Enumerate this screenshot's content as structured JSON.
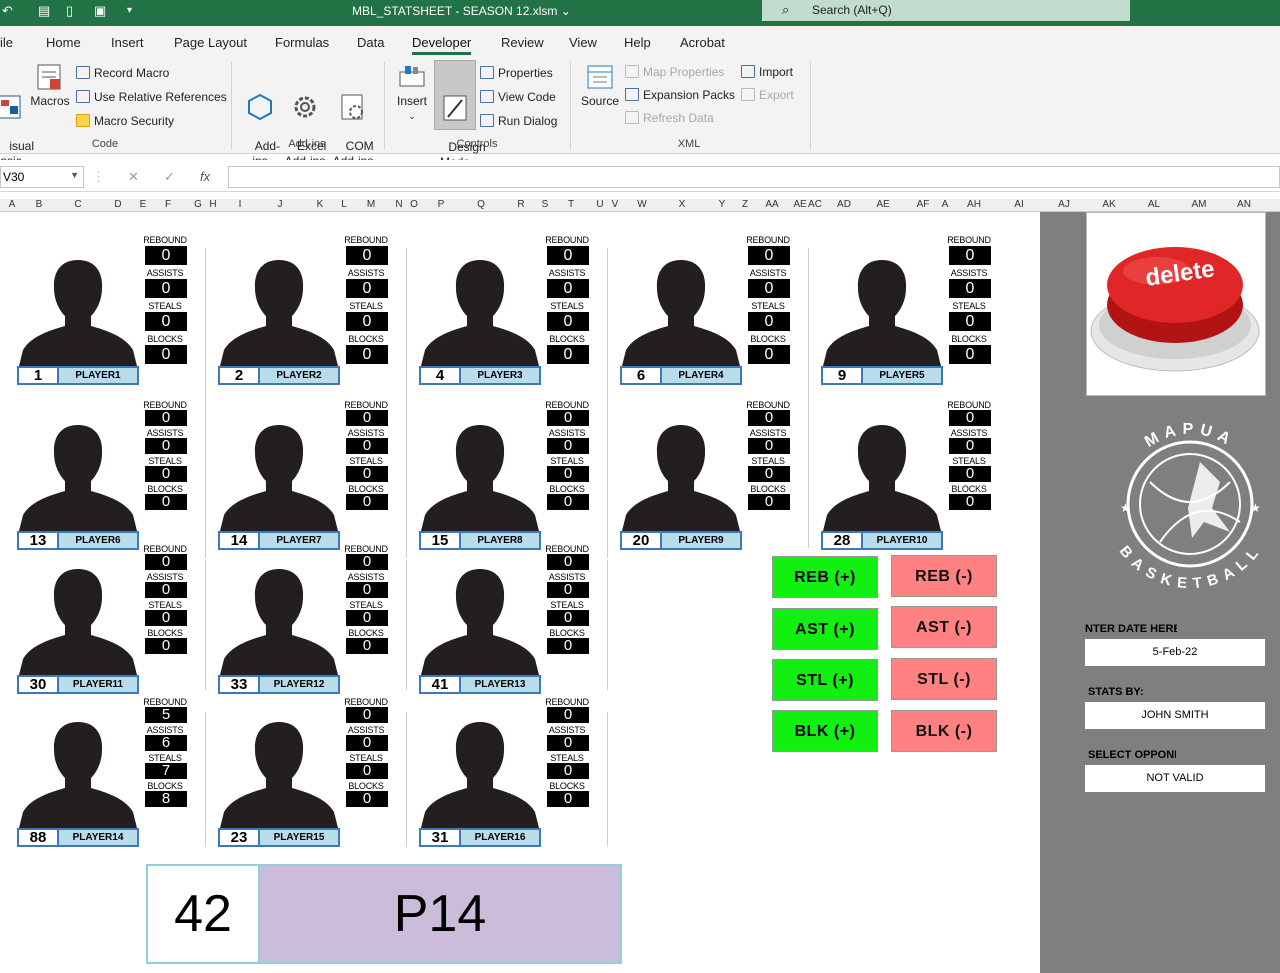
{
  "titlebar": {
    "doc_title": "MBL_STATSHEET - SEASON 12.xlsm",
    "search_placeholder": "Search (Alt+Q)"
  },
  "tabs": [
    "ile",
    "Home",
    "Insert",
    "Page Layout",
    "Formulas",
    "Data",
    "Developer",
    "Review",
    "View",
    "Help",
    "Acrobat"
  ],
  "ribbon": {
    "code": {
      "visual_basic": "isual\nasic",
      "macros": "Macros",
      "record_macro": "Record Macro",
      "relative_refs": "Use Relative References",
      "macro_security": "Macro Security",
      "group": "Code"
    },
    "addins": {
      "addins": "Add-\nins",
      "excel_addins": "Excel\nAdd-ins",
      "com_addins": "COM\nAdd-ins",
      "group": "Add-ins"
    },
    "controls": {
      "insert": "Insert",
      "design_mode": "Design\nMode",
      "properties": "Properties",
      "view_code": "View Code",
      "run_dialog": "Run Dialog",
      "group": "Controls"
    },
    "xml": {
      "source": "Source",
      "map_properties": "Map Properties",
      "expansion_packs": "Expansion Packs",
      "refresh_data": "Refresh Data",
      "import": "Import",
      "export": "Export",
      "group": "XML"
    }
  },
  "formula_bar": {
    "name_box": "V30",
    "fx": "fx"
  },
  "column_headers": [
    "A",
    "B",
    "C",
    "D",
    "E",
    "F",
    "G",
    "H",
    "I",
    "J",
    "K",
    "L",
    "M",
    "N",
    "O",
    "P",
    "Q",
    "R",
    "S",
    "T",
    "U",
    "V",
    "W",
    "X",
    "Y",
    "Z",
    "AA",
    "AE",
    "AC",
    "AD",
    "AE",
    "AF",
    "A",
    "AH",
    "AI",
    "AJ",
    "AK",
    "AL",
    "AM",
    "AN"
  ],
  "stat_labels": {
    "reb": "REBOUND",
    "ast": "ASSISTS",
    "stl": "STEALS",
    "blk": "BLOCKS"
  },
  "players": [
    {
      "num": "1",
      "name": "PLAYER1",
      "reb": "0",
      "ast": "0",
      "stl": "0",
      "blk": "0"
    },
    {
      "num": "2",
      "name": "PLAYER2",
      "reb": "0",
      "ast": "0",
      "stl": "0",
      "blk": "0"
    },
    {
      "num": "4",
      "name": "PLAYER3",
      "reb": "0",
      "ast": "0",
      "stl": "0",
      "blk": "0"
    },
    {
      "num": "6",
      "name": "PLAYER4",
      "reb": "0",
      "ast": "0",
      "stl": "0",
      "blk": "0"
    },
    {
      "num": "9",
      "name": "PLAYER5",
      "reb": "0",
      "ast": "0",
      "stl": "0",
      "blk": "0"
    },
    {
      "num": "13",
      "name": "PLAYER6",
      "reb": "0",
      "ast": "0",
      "stl": "0",
      "blk": "0"
    },
    {
      "num": "14",
      "name": "PLAYER7",
      "reb": "0",
      "ast": "0",
      "stl": "0",
      "blk": "0"
    },
    {
      "num": "15",
      "name": "PLAYER8",
      "reb": "0",
      "ast": "0",
      "stl": "0",
      "blk": "0"
    },
    {
      "num": "20",
      "name": "PLAYER9",
      "reb": "0",
      "ast": "0",
      "stl": "0",
      "blk": "0"
    },
    {
      "num": "28",
      "name": "PLAYER10",
      "reb": "0",
      "ast": "0",
      "stl": "0",
      "blk": "0"
    },
    {
      "num": "30",
      "name": "PLAYER11",
      "reb": "0",
      "ast": "0",
      "stl": "0",
      "blk": "0"
    },
    {
      "num": "33",
      "name": "PLAYER12",
      "reb": "0",
      "ast": "0",
      "stl": "0",
      "blk": "0"
    },
    {
      "num": "41",
      "name": "PLAYER13",
      "reb": "0",
      "ast": "0",
      "stl": "0",
      "blk": "0"
    },
    {
      "num": "88",
      "name": "PLAYER14",
      "reb": "5",
      "ast": "6",
      "stl": "7",
      "blk": "8"
    },
    {
      "num": "23",
      "name": "PLAYER15",
      "reb": "0",
      "ast": "0",
      "stl": "0",
      "blk": "0"
    },
    {
      "num": "31",
      "name": "PLAYER16",
      "reb": "0",
      "ast": "0",
      "stl": "0",
      "blk": "0"
    }
  ],
  "buttons": {
    "reb_plus": "REB (+)",
    "reb_minus": "REB (-)",
    "ast_plus": "AST (+)",
    "ast_minus": "AST (-)",
    "stl_plus": "STL (+)",
    "stl_minus": "STL (-)",
    "blk_plus": "BLK (+)",
    "blk_minus": "BLK (-)"
  },
  "selected": {
    "number": "42",
    "player": "P14"
  },
  "right_panel": {
    "delete_label": "delete",
    "logo_top": "MAPUA",
    "logo_bottom": "BASKETBALL",
    "date_label": "NTER DATE HERE",
    "date_value": "5-Feb-22",
    "stats_by_label": "STATS BY:",
    "stats_by_value": "JOHN SMITH",
    "opponent_label": "SELECT OPPONENT",
    "opponent_value": "NOT VALID"
  },
  "colors": {
    "excel_green": "#217346",
    "plus_button": "#11f011",
    "minus_button": "#ff8181",
    "name_fill": "#b9dceb",
    "selected_fill": "#cbbdd9"
  }
}
